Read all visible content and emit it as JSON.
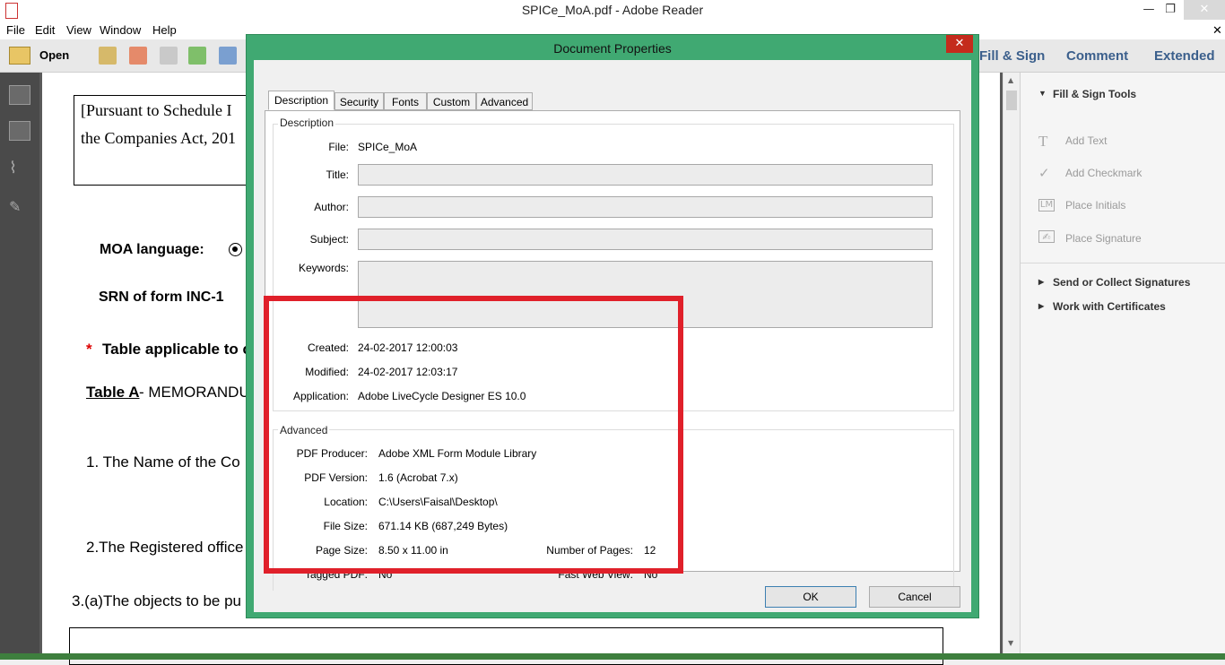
{
  "window": {
    "title": "SPICe_MoA.pdf - Adobe Reader",
    "minimize": "—",
    "maximize": "❐",
    "close": "✕"
  },
  "menu": [
    "File",
    "Edit",
    "View",
    "Window",
    "Help"
  ],
  "toolbar": {
    "open_label": "Open",
    "tabs": [
      "Fill & Sign",
      "Comment",
      "Extended"
    ]
  },
  "document": {
    "lines": [
      "[Pursuant to Schedule I",
      "the Companies Act, 201",
      "MOA language:",
      "SRN of form INC-1",
      "*",
      "Table applicable to c",
      "Table A",
      "- MEMORANDU",
      "1. The Name of the Co",
      "2.The Registered office",
      "3.(a)The objects to be pu"
    ]
  },
  "right_pane": {
    "section_title": "Fill & Sign Tools",
    "tools": [
      "Add Text",
      "Add Checkmark",
      "Place Initials",
      "Place Signature"
    ],
    "collapsed": [
      "Send or Collect Signatures",
      "Work with Certificates"
    ]
  },
  "dialog": {
    "title": "Document Properties",
    "tabs": [
      "Description",
      "Security",
      "Fonts",
      "Custom",
      "Advanced"
    ],
    "description_group": "Description",
    "file_label": "File:",
    "file_value": "SPICe_MoA",
    "title_label": "Title:",
    "author_label": "Author:",
    "subject_label": "Subject:",
    "keywords_label": "Keywords:",
    "created_label": "Created:",
    "created_value": "24-02-2017 12:00:03",
    "modified_label": "Modified:",
    "modified_value": "24-02-2017 12:03:17",
    "application_label": "Application:",
    "application_value": "Adobe LiveCycle Designer ES 10.0",
    "advanced_group": "Advanced",
    "pdf_producer_label": "PDF Producer:",
    "pdf_producer_value": "Adobe XML Form Module Library",
    "pdf_version_label": "PDF Version:",
    "pdf_version_value": "1.6 (Acrobat 7.x)",
    "location_label": "Location:",
    "location_value": "C:\\Users\\Faisal\\Desktop\\",
    "file_size_label": "File Size:",
    "file_size_value": "671.14 KB (687,249 Bytes)",
    "page_size_label": "Page Size:",
    "page_size_value": "8.50 x 11.00 in",
    "num_pages_label": "Number of Pages:",
    "num_pages_value": "12",
    "tagged_label": "Tagged PDF:",
    "tagged_value": "No",
    "fast_web_label": "Fast Web View:",
    "fast_web_value": "No",
    "ok_label": "OK",
    "cancel_label": "Cancel"
  },
  "colors": {
    "dialog_frame": "#40a972",
    "highlight": "#e0202a",
    "tab_text": "#3b5f8c"
  }
}
